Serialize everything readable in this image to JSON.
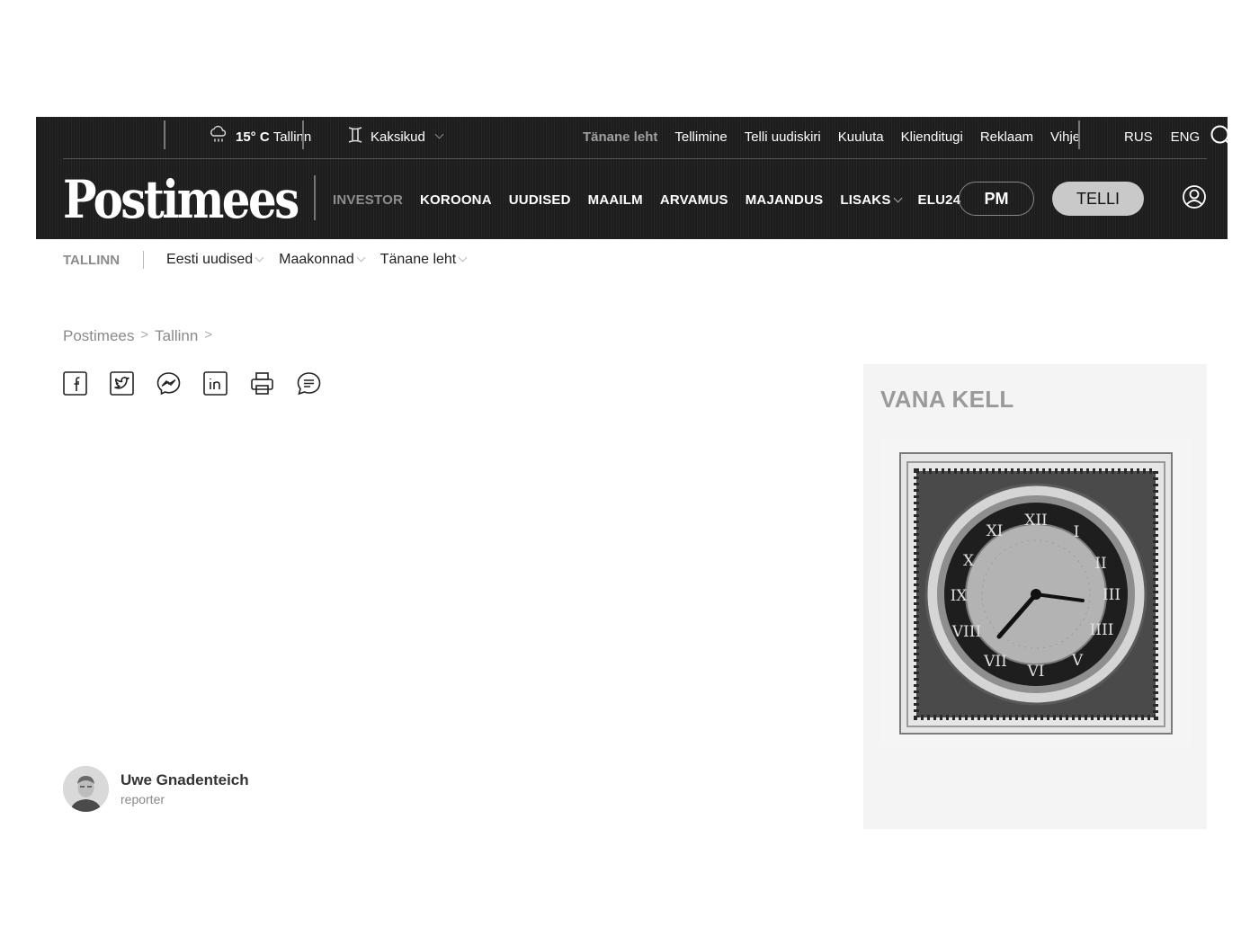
{
  "header": {
    "weather": {
      "icon": "rain-cloud-icon",
      "temperature": "15° C",
      "city": "Tallinn"
    },
    "zodiac": {
      "icon": "gemini-icon",
      "label": "Kaksikud"
    },
    "top_links": [
      "Tänane leht",
      "Tellimine",
      "Telli uudiskiri",
      "Kuuluta",
      "Klienditugi",
      "Reklaam",
      "Vihje"
    ],
    "languages": [
      "RUS",
      "ENG"
    ],
    "search_icon": "search-icon",
    "logo": "Postimees",
    "main_nav": [
      "INVESTOR",
      "KOROONA",
      "UUDISED",
      "MAAILM",
      "ARVAMUS",
      "MAJANDUS",
      "LISAKS",
      "ELU24"
    ],
    "pm_button": "PM",
    "subscribe_button": "TELLI",
    "user_icon": "user-circle-icon"
  },
  "subnav": {
    "section": "TALLINN",
    "items": [
      "Eesti uudised",
      "Maakonnad",
      "Tänane leht"
    ]
  },
  "breadcrumb": [
    "Postimees",
    ">",
    "Tallinn",
    ">"
  ],
  "share_icons": [
    "facebook-icon",
    "twitter-icon",
    "messenger-icon",
    "linkedin-icon",
    "print-icon",
    "comment-icon"
  ],
  "author": {
    "name": "Uwe Gnadenteich",
    "role": "reporter"
  },
  "sidebar": {
    "title": "VANA KELL"
  },
  "colors": {
    "masthead": "#1d1d1d",
    "muted_text": "#8a8a8a",
    "subscribe_bg": "#c9c9c9",
    "sidebar_bg": "#f4f4f4"
  }
}
